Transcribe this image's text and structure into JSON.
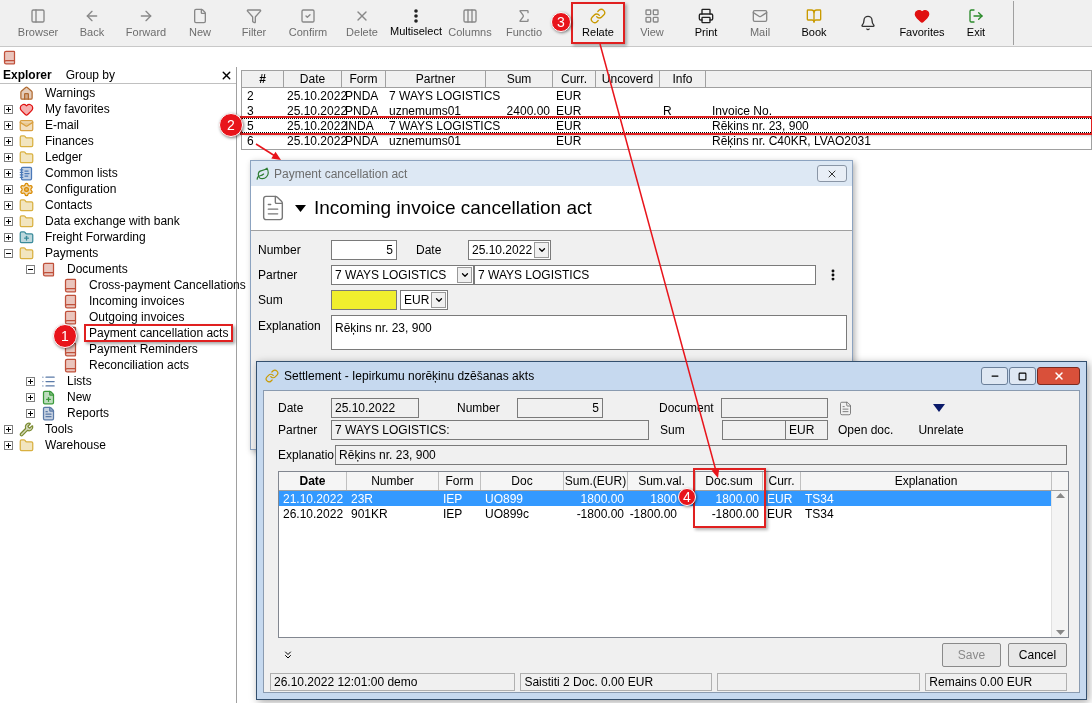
{
  "toolbar": {
    "items": [
      {
        "label": "Browser",
        "disabled": true,
        "highlighted": false
      },
      {
        "label": "Back",
        "disabled": true,
        "highlighted": false
      },
      {
        "label": "Forward",
        "disabled": true,
        "highlighted": false
      },
      {
        "label": "New",
        "disabled": true,
        "highlighted": false
      },
      {
        "label": "Filter",
        "disabled": true,
        "highlighted": false
      },
      {
        "label": "Confirm",
        "disabled": true,
        "highlighted": false
      },
      {
        "label": "Delete",
        "disabled": true,
        "highlighted": false
      },
      {
        "label": "Multiselect",
        "disabled": false,
        "highlighted": false
      },
      {
        "label": "Columns",
        "disabled": true,
        "highlighted": false
      },
      {
        "label": "Functio",
        "disabled": true,
        "highlighted": false
      },
      {
        "label": "Relate",
        "disabled": false,
        "highlighted": true
      },
      {
        "label": "View",
        "disabled": true,
        "highlighted": false
      },
      {
        "label": "Print",
        "disabled": false,
        "highlighted": false
      },
      {
        "label": "Mail",
        "disabled": true,
        "highlighted": false
      },
      {
        "label": "Book",
        "disabled": false,
        "highlighted": false
      },
      {
        "disabled": false,
        "highlighted": false
      },
      {
        "label": "Favorites",
        "disabled": false,
        "highlighted": false
      },
      {
        "label": "Exit",
        "disabled": false,
        "highlighted": false
      }
    ]
  },
  "explorer": {
    "tabs": [
      {
        "label": "Explorer",
        "selected": true
      },
      {
        "label": "Group by",
        "selected": false
      }
    ],
    "tree": [
      {
        "label": "Warnings",
        "kind": "home",
        "selected": false
      },
      {
        "label": "My favorites",
        "kind": "heart",
        "expanded": false,
        "selected": false
      },
      {
        "label": "E-mail",
        "kind": "mail",
        "expanded": false,
        "selected": false
      },
      {
        "label": "Finances",
        "kind": "folder",
        "expanded": false,
        "selected": false
      },
      {
        "label": "Ledger",
        "kind": "folder",
        "expanded": false,
        "selected": false
      },
      {
        "label": "Common lists",
        "kind": "list-book",
        "expanded": false,
        "selected": false
      },
      {
        "label": "Configuration",
        "kind": "gear",
        "expanded": false,
        "selected": false
      },
      {
        "label": "Contacts",
        "kind": "folder",
        "expanded": false,
        "selected": false
      },
      {
        "label": "Data exchange with bank",
        "kind": "folder",
        "expanded": false,
        "selected": false
      },
      {
        "label": "Freight Forwarding",
        "kind": "folder-plus",
        "expanded": false,
        "selected": false
      },
      {
        "label": "Payments",
        "kind": "folder",
        "expanded": true,
        "selected": false,
        "children": [
          {
            "label": "Documents",
            "kind": "book",
            "expanded": true,
            "selected": false,
            "children": [
              {
                "label": "Cross-payment Cancellations",
                "kind": "book",
                "selected": false
              },
              {
                "label": "Incoming invoices",
                "kind": "book",
                "selected": false
              },
              {
                "label": "Outgoing invoices",
                "kind": "book",
                "selected": false
              },
              {
                "label": "Payment cancellation acts",
                "kind": "book",
                "selected": true
              },
              {
                "label": "Payment Reminders",
                "kind": "book",
                "selected": false
              },
              {
                "label": "Reconciliation acts",
                "kind": "book",
                "selected": false
              }
            ]
          },
          {
            "label": "Lists",
            "kind": "list",
            "expanded": false,
            "selected": false
          },
          {
            "label": "New",
            "kind": "new",
            "expanded": false,
            "selected": false
          },
          {
            "label": "Reports",
            "kind": "report",
            "expanded": false,
            "selected": false
          }
        ]
      },
      {
        "label": "Tools",
        "kind": "tools",
        "expanded": false,
        "selected": false
      },
      {
        "label": "Warehouse",
        "kind": "folder",
        "expanded": false,
        "selected": false
      }
    ]
  },
  "list": {
    "columns": [
      "#",
      "Date",
      "Form",
      "Partner",
      "Sum",
      "Curr.",
      "Uncoverd",
      "Info"
    ],
    "rows": [
      {
        "number": "2",
        "date": "25.10.2022",
        "form": "PNDA",
        "partner": "7 WAYS LOGISTICS",
        "currency": "EUR",
        "selected": false
      },
      {
        "number": "3",
        "date": "25.10.2022",
        "form": "PNDA",
        "partner": "uznemums01",
        "sum": "2400.00",
        "currency": "EUR",
        "info": "R",
        "column_9": "Invoice No.",
        "selected": false
      },
      {
        "number": "5",
        "date": "25.10.2022",
        "form": "INDA",
        "partner": "7 WAYS LOGISTICS",
        "currency": "EUR",
        "column_9": "Rēķins nr. 23, 900",
        "selected": true
      },
      {
        "number": "6",
        "date": "25.10.2022",
        "form": "PNDA",
        "partner": "uznemums01",
        "currency": "EUR",
        "column_9": "Rēķins nr. C40KR, LVAO2031",
        "selected": false
      }
    ]
  },
  "payment_dialog": {
    "title": "Payment cancellation act",
    "heading": "Incoming invoice cancellation act",
    "number_label": "Number",
    "number": "5",
    "date_label": "Date",
    "date": "25.10.2022",
    "partner_label": "Partner",
    "partner_code": "7 WAYS LOGISTICS",
    "partner_name": "7 WAYS LOGISTICS",
    "sum_label": "Sum",
    "sum_highlighted": true,
    "currency": "EUR",
    "explanation_label": "Explanation",
    "explanation": "Rēķins nr. 23, 900"
  },
  "settlement": {
    "title": "Settlement - Iepirkumu norēķinu dzēšanas akts",
    "date_label": "Date",
    "date": "25.10.2022",
    "number_label": "Number",
    "number": "5",
    "document_label": "Document",
    "partner_label": "Partner",
    "partner": "7 WAYS LOGISTICS:",
    "sum_label": "Sum",
    "currency": "EUR",
    "explanation_label": "Explanatio",
    "explanation": "Rēķins nr. 23, 900",
    "open_doc": "Open doc.",
    "unrelate": "Unrelate",
    "columns": [
      {
        "label": "Date",
        "sorted": true,
        "highlighted": false
      },
      {
        "label": "Number",
        "sorted": false,
        "highlighted": false
      },
      {
        "label": "Form",
        "sorted": false,
        "highlighted": false
      },
      {
        "label": "Doc",
        "sorted": false,
        "highlighted": false
      },
      {
        "label": "Sum.(EUR)",
        "sorted": false,
        "highlighted": false
      },
      {
        "label": "Sum.val.",
        "sorted": false,
        "highlighted": false
      },
      {
        "label": "Doc.sum",
        "sorted": false,
        "highlighted": true
      },
      {
        "label": "Curr.",
        "sorted": false,
        "highlighted": false
      },
      {
        "label": "Explanation",
        "sorted": false,
        "highlighted": false
      }
    ],
    "rows": [
      {
        "date": "21.10.2022",
        "number": "23R",
        "form": "IEP",
        "doc": "UO899",
        "sum_eur": "1800.00",
        "sum_val": "1800",
        "doc_sum": "1800.00",
        "currency": "EUR",
        "explanation": "TS34",
        "selected": true
      },
      {
        "date": "26.10.2022",
        "number": "901KR",
        "form": "IEP",
        "doc": "UO899c",
        "sum_eur": "-1800.00",
        "sum_val": "-1800.00",
        "doc_sum": "-1800.00",
        "currency": "EUR",
        "explanation": "TS34",
        "selected": false
      }
    ],
    "buttons": [
      {
        "label": "Save",
        "disabled": true
      },
      {
        "label": "Cancel",
        "disabled": false
      }
    ],
    "status_bar": [
      "26.10.2022 12:01:00 demo",
      "Saistiti 2 Doc. 0.00 EUR",
      "Remains 0.00 EUR"
    ]
  },
  "callouts": [
    "1",
    "2",
    "3",
    "4"
  ]
}
